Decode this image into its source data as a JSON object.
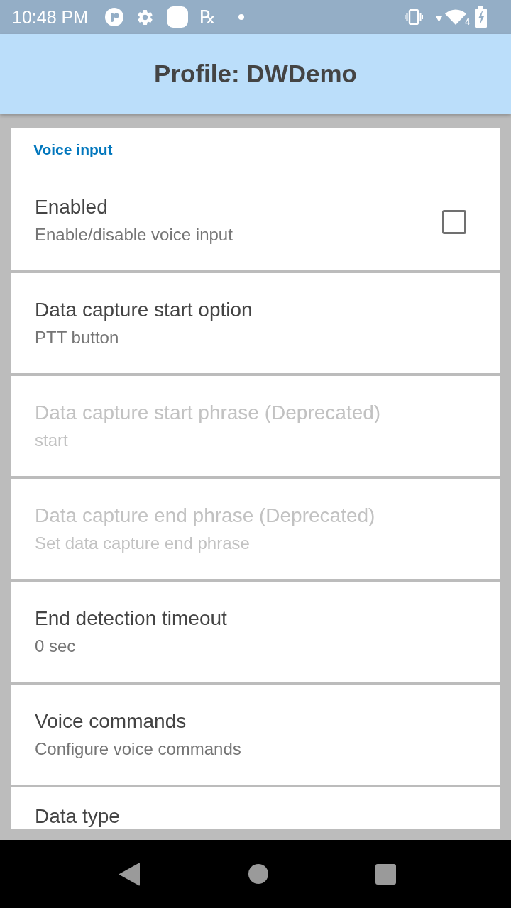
{
  "status_bar": {
    "time": "10:48 PM",
    "notification_glyph": "℞",
    "wifi_label": "4"
  },
  "app_bar": {
    "title": "Profile: DWDemo"
  },
  "section": {
    "title": "Voice input"
  },
  "preferences": [
    {
      "kind": "checkbox",
      "title": "Enabled",
      "summary": "Enable/disable voice input",
      "checked": false,
      "disabled": false
    },
    {
      "kind": "text",
      "title": "Data capture start option",
      "summary": "PTT button",
      "disabled": false
    },
    {
      "kind": "text",
      "title": "Data capture start phrase (Deprecated)",
      "summary": "start",
      "disabled": true
    },
    {
      "kind": "text",
      "title": "Data capture end phrase (Deprecated)",
      "summary": "Set data capture end phrase",
      "disabled": true
    },
    {
      "kind": "text",
      "title": "End detection timeout",
      "summary": "0 sec",
      "disabled": false
    },
    {
      "kind": "text",
      "title": "Voice commands",
      "summary": "Configure voice commands",
      "disabled": false
    },
    {
      "kind": "text",
      "title": "Data type",
      "disabled": false
    }
  ]
}
